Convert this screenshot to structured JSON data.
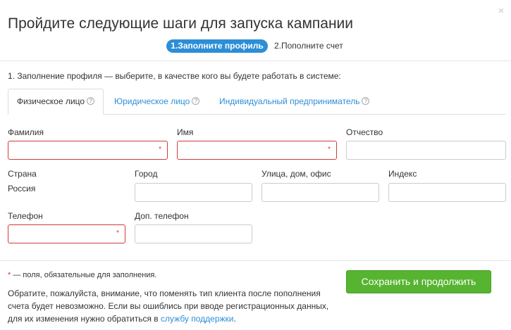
{
  "dialog": {
    "title": "Пройдите следующие шаги для запуска кампании",
    "close_glyph": "×"
  },
  "steps": {
    "active": "1.Заполните профиль",
    "next": "2.Пополните счет"
  },
  "intro": "1. Заполнение профиля — выберите, в качестве кого вы будете работать в системе:",
  "tabs": [
    {
      "label": "Физическое лицо",
      "active": true
    },
    {
      "label": "Юридическое лицо",
      "active": false
    },
    {
      "label": "Индивидуальный предприниматель",
      "active": false
    }
  ],
  "help_glyph": "?",
  "form": {
    "last_name": {
      "label": "Фамилия",
      "value": "",
      "required_mark": "*"
    },
    "first_name": {
      "label": "Имя",
      "value": "",
      "required_mark": "*"
    },
    "patronymic": {
      "label": "Отчество",
      "value": ""
    },
    "country": {
      "label": "Страна",
      "value": "Россия"
    },
    "city": {
      "label": "Город",
      "value": ""
    },
    "street": {
      "label": "Улица, дом, офис",
      "value": ""
    },
    "zip": {
      "label": "Индекс",
      "value": ""
    },
    "phone": {
      "label": "Телефон",
      "value": "",
      "required_mark": "*"
    },
    "extra_phone": {
      "label": "Доп. телефон",
      "value": ""
    }
  },
  "footer": {
    "required_star": "*",
    "required_legend": " — поля, обязательные для заполнения.",
    "note": "Обратите, пожалуйста, внимание, что поменять тип клиента после пополнения счета будет невозможно. Если вы ошиблись при вводе регистрационных данных, для их изменения нужно обратиться в ",
    "support_link": "службу поддержки",
    "note_end": ".",
    "save_label": "Сохранить и продолжить"
  },
  "colors": {
    "accent_blue": "#2c8ed6",
    "button_green": "#57b430",
    "required_red": "#cf3b3b"
  }
}
